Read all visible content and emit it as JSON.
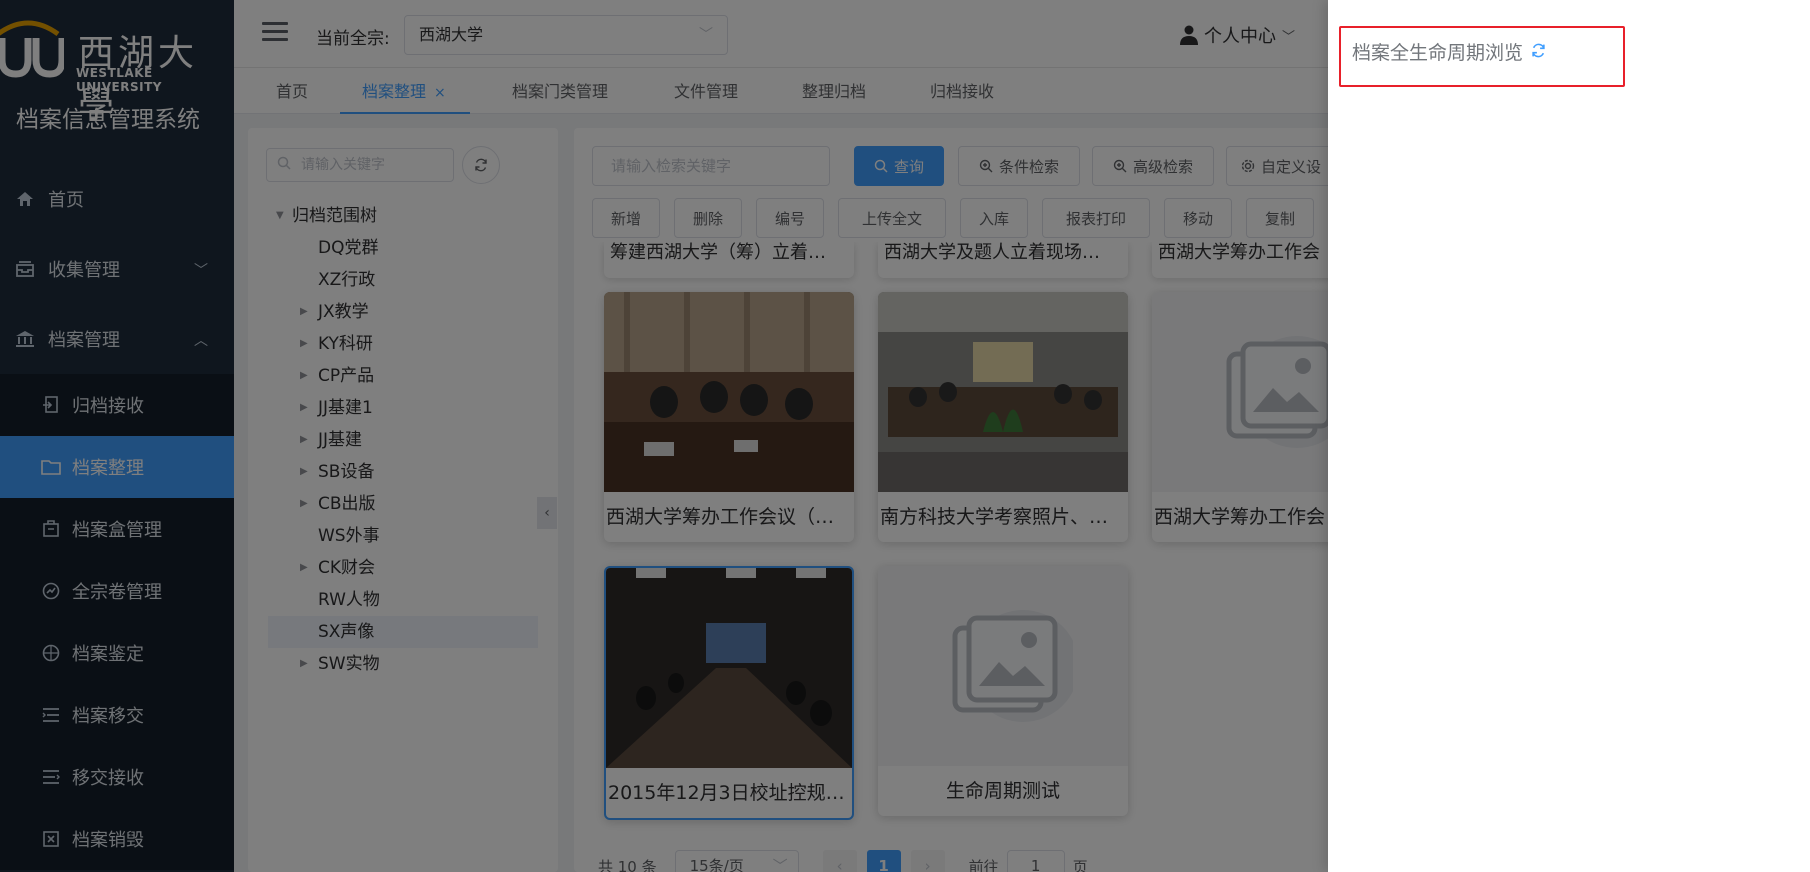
{
  "sidebar": {
    "logo_cn": "西湖大學",
    "logo_en": "WESTLAKE UNIVERSITY",
    "system_title": "档案信息管理系统",
    "items": [
      {
        "label": "首页",
        "icon": "home-icon"
      },
      {
        "label": "收集管理",
        "icon": "inbox-icon"
      },
      {
        "label": "档案管理",
        "icon": "institution-icon"
      }
    ],
    "subitems": [
      {
        "label": "归档接收",
        "icon": "receive-icon"
      },
      {
        "label": "档案整理",
        "icon": "folder-icon"
      },
      {
        "label": "档案盒管理",
        "icon": "box-icon"
      },
      {
        "label": "全宗卷管理",
        "icon": "gauge-icon"
      },
      {
        "label": "档案鉴定",
        "icon": "compass-icon"
      },
      {
        "label": "档案移交",
        "icon": "list-icon"
      },
      {
        "label": "移交接收",
        "icon": "transfer-icon"
      },
      {
        "label": "档案销毁",
        "icon": "destroy-icon"
      }
    ]
  },
  "header": {
    "fonds_label": "当前全宗:",
    "fonds_value": "西湖大学",
    "user_center": "个人中心"
  },
  "tabs": [
    {
      "label": "首页"
    },
    {
      "label": "档案整理",
      "close": "×"
    },
    {
      "label": "档案门类管理"
    },
    {
      "label": "文件管理"
    },
    {
      "label": "整理归档"
    },
    {
      "label": "归档接收"
    }
  ],
  "tree": {
    "search_placeholder": "请输入关键字",
    "root": "归档范围树",
    "nodes": [
      "DQ党群",
      "XZ行政",
      "JX教学",
      "KY科研",
      "CP产品",
      "JJ基建1",
      "JJ基建",
      "SB设备",
      "CB出版",
      "WS外事",
      "CK财会",
      "RW人物",
      "SX声像",
      "SW实物"
    ]
  },
  "toolbar": {
    "search_placeholder": "请输入检索关键字",
    "query": "查询",
    "condition_search": "条件检索",
    "advanced_search": "高级检索",
    "custom_settings": "自定义设",
    "actions": [
      "新增",
      "删除",
      "编号",
      "上传全文",
      "入库",
      "报表打印",
      "移动",
      "复制"
    ]
  },
  "cards": {
    "partial_row": [
      "筹建西湖大学（筹）立着…",
      "西湖大学及题人立着现场…",
      "西湖大学筹办工作会"
    ],
    "row1": [
      "西湖大学筹办工作会议（…",
      "南方科技大学考察照片、…",
      "西湖大学筹办工作会"
    ],
    "row2": [
      "2015年12月3日校址控规…",
      "生命周期测试"
    ]
  },
  "pagination": {
    "total": "共 10 条",
    "page_size": "15条/页",
    "current_page": "1",
    "goto_label": "前往",
    "goto_value": "1",
    "page_suffix": "页"
  },
  "drawer": {
    "title": "档案全生命周期浏览"
  },
  "colors": {
    "sidebar_bg": "#1f2d3d",
    "accent": "#409eff",
    "highlight": "#e8202a"
  }
}
